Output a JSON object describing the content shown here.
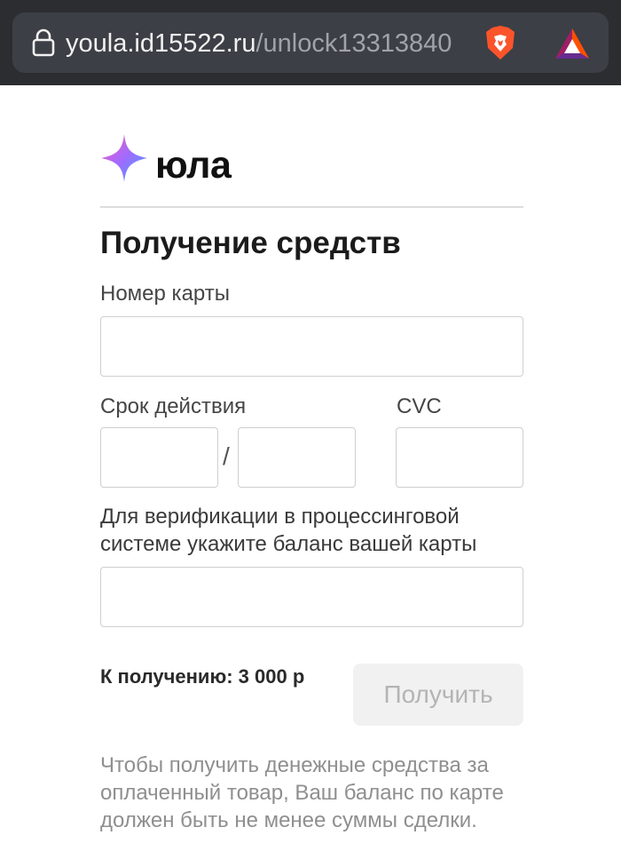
{
  "browser": {
    "url_domain": "youla.id15522.ru",
    "url_path": "/unlock13313840"
  },
  "brand": {
    "name": "юла"
  },
  "form": {
    "title": "Получение средств",
    "card_number_label": "Номер карты",
    "card_number_value": "",
    "expiry_label": "Срок действия",
    "expiry_month_value": "",
    "expiry_separator": "/",
    "expiry_year_value": "",
    "cvc_label": "CVC",
    "cvc_value": "",
    "balance_label": "Для верификации в процессинговой системе укажите баланс вашей карты",
    "balance_value": "",
    "amount_text": "К получению: 3 000 р",
    "submit_label": "Получить",
    "note": "Чтобы получить денежные средства за оплаченный товар, Ваш баланс по карте должен быть не менее суммы сделки."
  }
}
